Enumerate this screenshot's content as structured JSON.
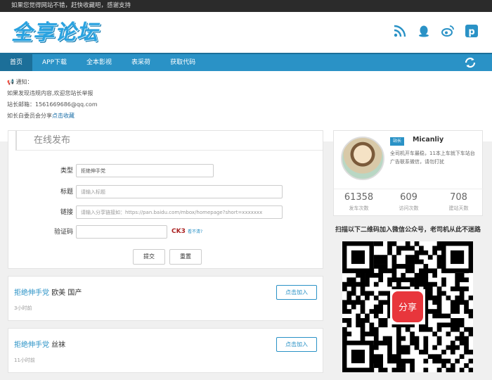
{
  "topbar": {
    "text": "如果您觉得网站不错，赶快收藏吧，感谢支持"
  },
  "header": {
    "logo": "全享论坛",
    "social": [
      {
        "icon": "rss-icon",
        "color": "#2a92c6"
      },
      {
        "icon": "qq-icon",
        "color": "#2a92c6"
      },
      {
        "icon": "weibo-icon",
        "color": "#2a92c6"
      },
      {
        "icon": "pinterest-icon",
        "color": "#2a92c6"
      }
    ]
  },
  "nav": {
    "items": [
      "首页",
      "APP下载",
      "全本影视",
      "表采荷",
      "获取代码"
    ]
  },
  "notice": {
    "line1": "通知：",
    "line2": "如果发现违规内容,欢迎您站长举报",
    "line3": "站长邮箱：1561669686@qq.com",
    "line4_a": "如长白委员会分享",
    "line4_b": "点击收藏"
  },
  "form": {
    "title": "在线发布",
    "type_label": "类型",
    "type_value": "拒绝伸手党",
    "title_label": "标题",
    "title_placeholder": "请输入标题",
    "link_label": "链接",
    "link_placeholder": "请输入分享链接如：https://pan.baidu.com/mbox/homepage?short=xxxxxxx",
    "captcha_label": "验证码",
    "captcha_text": "CK3",
    "captcha_refresh": "看不清?",
    "submit": "提交",
    "reset": "重置"
  },
  "posts": [
    {
      "tag": "拒绝伸手党",
      "title": "欧美 国产",
      "time": "3小时前",
      "action": "点击加入"
    },
    {
      "tag": "拒绝伸手党",
      "title": "丝袜",
      "time": "11小时前",
      "action": "点击加入"
    }
  ],
  "profile": {
    "badge": "站长",
    "name": "Micanliy",
    "bio": "全司机开车最稳，11本上车就下车站台广告联系微信，请勿打扰",
    "stats": [
      {
        "n": "61358",
        "l": "发车次数"
      },
      {
        "n": "609",
        "l": "访问次数"
      },
      {
        "n": "708",
        "l": "建站天数"
      }
    ]
  },
  "qr": {
    "title": "扫描以下二维码加入微信公众号，老司机从此不迷路",
    "center": "分享"
  }
}
